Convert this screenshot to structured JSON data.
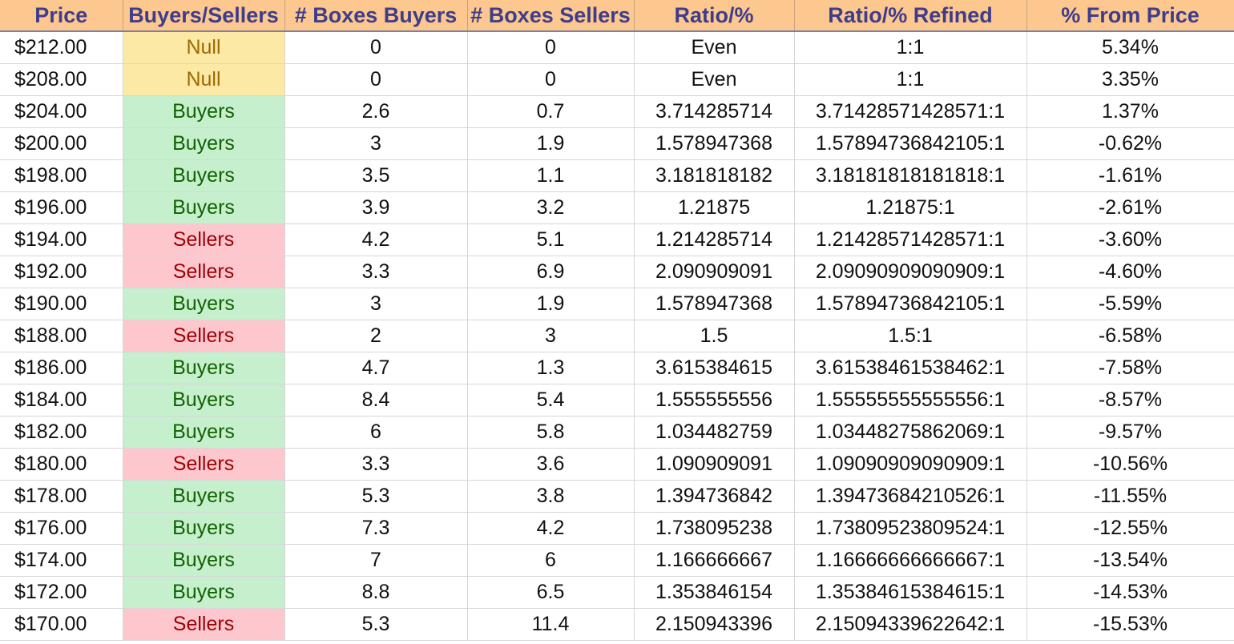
{
  "colors": {
    "header_bg": "#fcc890",
    "header_text": "#3f3c8a",
    "null_bg": "#fde9a6",
    "null_text": "#9c6a00",
    "buyers_bg": "#c6efce",
    "buyers_text": "#116100",
    "sellers_bg": "#fec7ce",
    "sellers_text": "#9c0006"
  },
  "headers": [
    "Price",
    "Buyers/Sellers",
    "# Boxes Buyers",
    "# Boxes Sellers",
    "Ratio/%",
    "Ratio/% Refined",
    "% From Price"
  ],
  "rows": [
    {
      "price": "$212.00",
      "side": "Null",
      "buyers": "0",
      "sellers": "0",
      "ratio": "Even",
      "refined": "1:1",
      "pct": "5.34%"
    },
    {
      "price": "$208.00",
      "side": "Null",
      "buyers": "0",
      "sellers": "0",
      "ratio": "Even",
      "refined": "1:1",
      "pct": "3.35%"
    },
    {
      "price": "$204.00",
      "side": "Buyers",
      "buyers": "2.6",
      "sellers": "0.7",
      "ratio": "3.714285714",
      "refined": "3.71428571428571:1",
      "pct": "1.37%"
    },
    {
      "price": "$200.00",
      "side": "Buyers",
      "buyers": "3",
      "sellers": "1.9",
      "ratio": "1.578947368",
      "refined": "1.57894736842105:1",
      "pct": "-0.62%"
    },
    {
      "price": "$198.00",
      "side": "Buyers",
      "buyers": "3.5",
      "sellers": "1.1",
      "ratio": "3.181818182",
      "refined": "3.18181818181818:1",
      "pct": "-1.61%"
    },
    {
      "price": "$196.00",
      "side": "Buyers",
      "buyers": "3.9",
      "sellers": "3.2",
      "ratio": "1.21875",
      "refined": "1.21875:1",
      "pct": "-2.61%"
    },
    {
      "price": "$194.00",
      "side": "Sellers",
      "buyers": "4.2",
      "sellers": "5.1",
      "ratio": "1.214285714",
      "refined": "1.21428571428571:1",
      "pct": "-3.60%"
    },
    {
      "price": "$192.00",
      "side": "Sellers",
      "buyers": "3.3",
      "sellers": "6.9",
      "ratio": "2.090909091",
      "refined": "2.09090909090909:1",
      "pct": "-4.60%"
    },
    {
      "price": "$190.00",
      "side": "Buyers",
      "buyers": "3",
      "sellers": "1.9",
      "ratio": "1.578947368",
      "refined": "1.57894736842105:1",
      "pct": "-5.59%"
    },
    {
      "price": "$188.00",
      "side": "Sellers",
      "buyers": "2",
      "sellers": "3",
      "ratio": "1.5",
      "refined": "1.5:1",
      "pct": "-6.58%"
    },
    {
      "price": "$186.00",
      "side": "Buyers",
      "buyers": "4.7",
      "sellers": "1.3",
      "ratio": "3.615384615",
      "refined": "3.61538461538462:1",
      "pct": "-7.58%"
    },
    {
      "price": "$184.00",
      "side": "Buyers",
      "buyers": "8.4",
      "sellers": "5.4",
      "ratio": "1.555555556",
      "refined": "1.55555555555556:1",
      "pct": "-8.57%"
    },
    {
      "price": "$182.00",
      "side": "Buyers",
      "buyers": "6",
      "sellers": "5.8",
      "ratio": "1.034482759",
      "refined": "1.03448275862069:1",
      "pct": "-9.57%"
    },
    {
      "price": "$180.00",
      "side": "Sellers",
      "buyers": "3.3",
      "sellers": "3.6",
      "ratio": "1.090909091",
      "refined": "1.09090909090909:1",
      "pct": "-10.56%"
    },
    {
      "price": "$178.00",
      "side": "Buyers",
      "buyers": "5.3",
      "sellers": "3.8",
      "ratio": "1.394736842",
      "refined": "1.39473684210526:1",
      "pct": "-11.55%"
    },
    {
      "price": "$176.00",
      "side": "Buyers",
      "buyers": "7.3",
      "sellers": "4.2",
      "ratio": "1.738095238",
      "refined": "1.73809523809524:1",
      "pct": "-12.55%"
    },
    {
      "price": "$174.00",
      "side": "Buyers",
      "buyers": "7",
      "sellers": "6",
      "ratio": "1.166666667",
      "refined": "1.16666666666667:1",
      "pct": "-13.54%"
    },
    {
      "price": "$172.00",
      "side": "Buyers",
      "buyers": "8.8",
      "sellers": "6.5",
      "ratio": "1.353846154",
      "refined": "1.35384615384615:1",
      "pct": "-14.53%"
    },
    {
      "price": "$170.00",
      "side": "Sellers",
      "buyers": "5.3",
      "sellers": "11.4",
      "ratio": "2.150943396",
      "refined": "2.15094339622642:1",
      "pct": "-15.53%"
    }
  ]
}
